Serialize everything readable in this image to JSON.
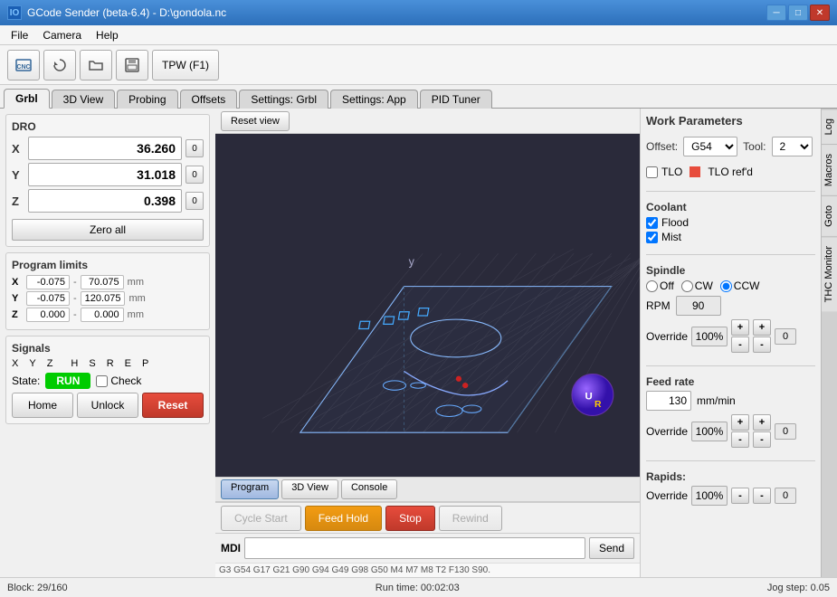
{
  "titlebar": {
    "icon": "IO",
    "title": "GCode Sender (beta-6.4) - D:\\gondola.nc",
    "min_btn": "─",
    "max_btn": "□",
    "close_btn": "✕"
  },
  "menubar": {
    "items": [
      "File",
      "Camera",
      "Help"
    ]
  },
  "toolbar": {
    "tpw_label": "TPW (F1)"
  },
  "tabs": {
    "items": [
      "Grbl",
      "3D View",
      "Probing",
      "Offsets",
      "Settings: Grbl",
      "Settings: App",
      "PID Tuner"
    ],
    "active": 0
  },
  "dro": {
    "title": "DRO",
    "x": {
      "label": "X",
      "value": "36.260",
      "zero_label": "0"
    },
    "y": {
      "label": "Y",
      "value": "31.018",
      "zero_label": "0"
    },
    "z": {
      "label": "Z",
      "value": "0.398",
      "zero_label": "0"
    },
    "zero_all": "Zero all"
  },
  "program_limits": {
    "title": "Program limits",
    "x": {
      "label": "X",
      "min": "-0.075",
      "max": "70.075",
      "unit": "mm"
    },
    "y": {
      "label": "Y",
      "min": "-0.075",
      "max": "120.075",
      "unit": "mm"
    },
    "z": {
      "label": "Z",
      "min": "0.000",
      "max": "0.000",
      "unit": "mm"
    }
  },
  "signals": {
    "title": "Signals",
    "labels": [
      "X",
      "Y",
      "Z",
      "H",
      "S",
      "R",
      "E",
      "P"
    ]
  },
  "state": {
    "label": "State:",
    "value": "RUN",
    "check_label": "Check"
  },
  "action_buttons": {
    "home": "Home",
    "unlock": "Unlock",
    "reset": "Reset"
  },
  "mdi": {
    "title": "MDI",
    "placeholder": "",
    "send": "Send",
    "gcode_hint": "G3 G54 G17 G21 G90 G94 G49 G98 G50 M4 M7 M8 T2 F130 S90."
  },
  "statusbar": {
    "block": "Block: 29/160",
    "runtime": "Run time: 00:02:03",
    "jog_step": "Jog step: 0.05"
  },
  "viz": {
    "reset_view": "Reset view",
    "sub_tabs": [
      "Program",
      "3D View",
      "Console"
    ],
    "active_sub_tab": 0
  },
  "controls": {
    "cycle_start": "Cycle Start",
    "feed_hold": "Feed Hold",
    "stop": "Stop",
    "rewind": "Rewind"
  },
  "work_params": {
    "title": "Work Parameters",
    "offset_label": "Offset:",
    "offset_value": "G54",
    "tool_label": "Tool:",
    "tool_value": "2",
    "tlo_label": "TLO",
    "tlo_refd_label": "TLO ref'd",
    "coolant_title": "Coolant",
    "flood_label": "Flood",
    "mist_label": "Mist",
    "spindle_title": "Spindle",
    "spindle_options": [
      "Off",
      "CW",
      "CCW"
    ],
    "spindle_active": "CCW",
    "rpm_label": "RPM",
    "rpm_value": "90",
    "override_label": "Override",
    "spindle_override": "100%",
    "spindle_zero": "0",
    "feed_rate_title": "Feed rate",
    "feed_value": "130",
    "feed_unit": "mm/min",
    "feed_override": "100%",
    "feed_zero": "0",
    "rapids_title": "Rapids:",
    "rapids_override": "100%",
    "rapids_zero": "0"
  },
  "side_tabs": [
    "Log",
    "Macros",
    "Goto",
    "THC Monitor"
  ]
}
